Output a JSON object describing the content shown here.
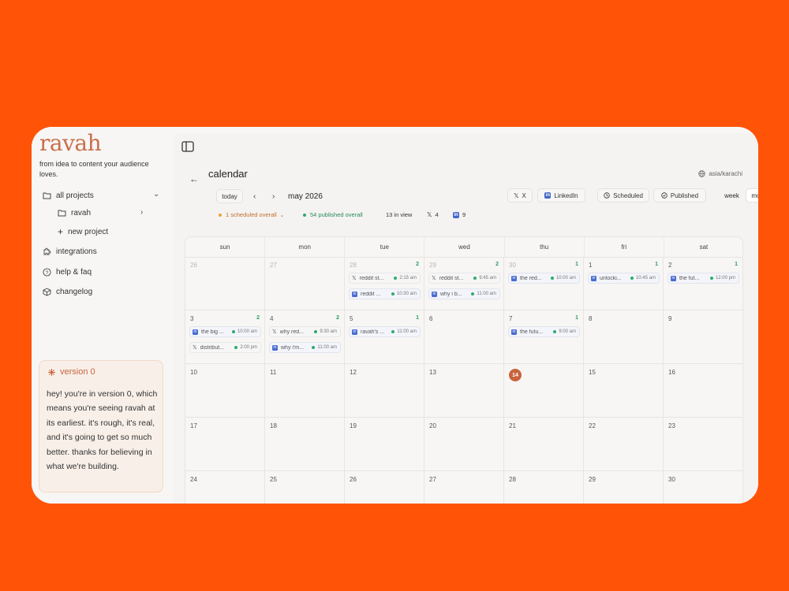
{
  "sidebar": {
    "logo": "ravah",
    "tagline": "from idea to content your audience loves.",
    "nav": {
      "all_projects": "all projects",
      "project_ravah": "ravah",
      "new_project": "new project",
      "integrations": "integrations",
      "help": "help & faq",
      "changelog": "changelog"
    },
    "version_card": {
      "title": "version 0",
      "body": "hey! you're in version 0, which means you're seeing ravah at its earliest. it's rough, it's real, and it's going to get so much better. thanks for believing in what we're building."
    }
  },
  "header": {
    "title": "calendar",
    "timezone": "asia/karachi",
    "today_label": "today",
    "month_label": "may 2026",
    "filters": {
      "x": "X",
      "linkedin": "LinkedIn",
      "scheduled": "Scheduled",
      "published": "Published"
    },
    "view": {
      "week": "week",
      "month": "month"
    }
  },
  "stats": {
    "scheduled": "1 scheduled overall",
    "published": "54 published overall",
    "in_view": "13 in view",
    "x_count": "4",
    "linkedin_count": "9"
  },
  "colors": {
    "accent": "#c8643c",
    "background": "#ff5408",
    "published_green": "#2faa6e",
    "linkedin_blue": "#4a6cd0"
  },
  "calendar": {
    "weekdays": [
      "sun",
      "mon",
      "tue",
      "wed",
      "thu",
      "fri",
      "sat"
    ],
    "today": "14",
    "weeks": [
      [
        {
          "day": "26",
          "dim": true,
          "count": "",
          "events": []
        },
        {
          "day": "27",
          "dim": true,
          "count": "",
          "events": []
        },
        {
          "day": "28",
          "dim": true,
          "count": "2",
          "events": [
            {
              "platform": "x",
              "text": "reddit st...",
              "time": "2:15 am"
            },
            {
              "platform": "linkedin",
              "text": "reddit ...",
              "time": "10:30 am"
            }
          ]
        },
        {
          "day": "29",
          "dim": true,
          "count": "2",
          "events": [
            {
              "platform": "x",
              "text": "reddit st...",
              "time": "9:45 am"
            },
            {
              "platform": "linkedin",
              "text": "why i b...",
              "time": "11:00 am"
            }
          ]
        },
        {
          "day": "30",
          "dim": true,
          "count": "1",
          "events": [
            {
              "platform": "linkedin",
              "text": "the red...",
              "time": "10:00 am"
            }
          ]
        },
        {
          "day": "1",
          "dim": false,
          "count": "1",
          "events": [
            {
              "platform": "linkedin",
              "text": "unlocki...",
              "time": "10:45 am"
            }
          ]
        },
        {
          "day": "2",
          "dim": false,
          "count": "1",
          "events": [
            {
              "platform": "linkedin",
              "text": "the fut...",
              "time": "12:00 pm"
            }
          ]
        }
      ],
      [
        {
          "day": "3",
          "dim": false,
          "count": "2",
          "events": [
            {
              "platform": "linkedin",
              "text": "the big ...",
              "time": "10:00 am"
            },
            {
              "platform": "x",
              "text": "distribut...",
              "time": "2:00 pm"
            }
          ]
        },
        {
          "day": "4",
          "dim": false,
          "count": "2",
          "events": [
            {
              "platform": "x",
              "text": "why red...",
              "time": "9:30 am"
            },
            {
              "platform": "linkedin",
              "text": "why i'm...",
              "time": "11:00 am"
            }
          ]
        },
        {
          "day": "5",
          "dim": false,
          "count": "1",
          "events": [
            {
              "platform": "linkedin",
              "text": "ravah's ...",
              "time": "11:00 am"
            }
          ]
        },
        {
          "day": "6",
          "dim": false,
          "count": "",
          "events": []
        },
        {
          "day": "7",
          "dim": false,
          "count": "1",
          "events": [
            {
              "platform": "linkedin",
              "text": "the futu...",
              "time": "9:00 am"
            }
          ]
        },
        {
          "day": "8",
          "dim": false,
          "count": "",
          "events": []
        },
        {
          "day": "9",
          "dim": false,
          "count": "",
          "events": []
        }
      ],
      [
        {
          "day": "10",
          "dim": false,
          "count": "",
          "events": []
        },
        {
          "day": "11",
          "dim": false,
          "count": "",
          "events": []
        },
        {
          "day": "12",
          "dim": false,
          "count": "",
          "events": []
        },
        {
          "day": "13",
          "dim": false,
          "count": "",
          "events": []
        },
        {
          "day": "14",
          "dim": false,
          "count": "",
          "events": []
        },
        {
          "day": "15",
          "dim": false,
          "count": "",
          "events": []
        },
        {
          "day": "16",
          "dim": false,
          "count": "",
          "events": []
        }
      ],
      [
        {
          "day": "17",
          "dim": false,
          "count": "",
          "events": []
        },
        {
          "day": "18",
          "dim": false,
          "count": "",
          "events": []
        },
        {
          "day": "19",
          "dim": false,
          "count": "",
          "events": []
        },
        {
          "day": "20",
          "dim": false,
          "count": "",
          "events": []
        },
        {
          "day": "21",
          "dim": false,
          "count": "",
          "events": []
        },
        {
          "day": "22",
          "dim": false,
          "count": "",
          "events": []
        },
        {
          "day": "23",
          "dim": false,
          "count": "",
          "events": []
        }
      ],
      [
        {
          "day": "24",
          "dim": false,
          "count": "",
          "events": []
        },
        {
          "day": "25",
          "dim": false,
          "count": "",
          "events": []
        },
        {
          "day": "26",
          "dim": false,
          "count": "",
          "events": []
        },
        {
          "day": "27",
          "dim": false,
          "count": "",
          "events": []
        },
        {
          "day": "28",
          "dim": false,
          "count": "",
          "events": []
        },
        {
          "day": "29",
          "dim": false,
          "count": "",
          "events": []
        },
        {
          "day": "30",
          "dim": false,
          "count": "",
          "events": []
        }
      ]
    ]
  }
}
